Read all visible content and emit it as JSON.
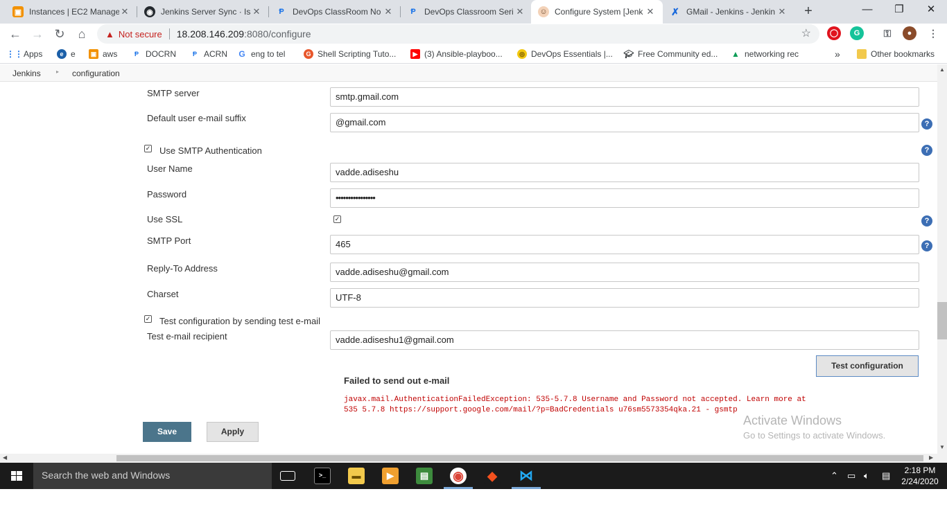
{
  "browser": {
    "tabs": [
      {
        "title": "Instances | EC2 Manage",
        "icon": "aws-icon"
      },
      {
        "title": "Jenkins Server Sync · Iss",
        "icon": "github-icon"
      },
      {
        "title": "DevOps ClassRoom No",
        "icon": "docs-icon"
      },
      {
        "title": "DevOps Classroom Seri",
        "icon": "docs-icon"
      },
      {
        "title": "Configure System [Jenk",
        "icon": "jenkins-icon"
      },
      {
        "title": "GMail - Jenkins - Jenkin",
        "icon": "confluence-icon"
      }
    ],
    "not_secure": "Not secure",
    "url_host": "18.208.146.209",
    "url_path": ":8080/configure"
  },
  "bookmarks": {
    "items": [
      {
        "label": "Apps"
      },
      {
        "label": "e"
      },
      {
        "label": "aws"
      },
      {
        "label": "DOCRN"
      },
      {
        "label": "ACRN"
      },
      {
        "label": "eng to tel"
      },
      {
        "label": "Shell Scripting Tuto..."
      },
      {
        "label": "(3) Ansible-playboo..."
      },
      {
        "label": "DevOps Essentials |..."
      },
      {
        "label": "Free Community ed..."
      },
      {
        "label": "networking rec"
      }
    ],
    "more": "»",
    "other": "Other bookmarks"
  },
  "breadcrumb": {
    "root": "Jenkins",
    "current": "configuration"
  },
  "form": {
    "smtp_server_label": "SMTP server",
    "smtp_server_value": "smtp.gmail.com",
    "suffix_label": "Default user e-mail suffix",
    "suffix_value": "@gmail.com",
    "use_smtp_auth_label": "Use SMTP Authentication",
    "use_smtp_auth_checked": true,
    "username_label": "User Name",
    "username_value": "vadde.adiseshu",
    "password_label": "Password",
    "password_value": "••••••••••••••••",
    "use_ssl_label": "Use SSL",
    "use_ssl_checked": true,
    "smtp_port_label": "SMTP Port",
    "smtp_port_value": "465",
    "reply_to_label": "Reply-To Address",
    "reply_to_value": "vadde.adiseshu@gmail.com",
    "charset_label": "Charset",
    "charset_value": "UTF-8",
    "test_config_label": "Test configuration by sending test e-mail",
    "test_config_checked": true,
    "test_recipient_label": "Test e-mail recipient",
    "test_recipient_value": "vadde.adiseshu1@gmail.com",
    "test_button": "Test configuration",
    "fail_heading": "Failed to send out e-mail",
    "error_line1": "javax.mail.AuthenticationFailedException: 535-5.7.8 Username and Password not accepted. Learn more at",
    "error_line2": "535 5.7.8  https://support.google.com/mail/?p=BadCredentials u76sm5573354qka.21 - gsmtp",
    "save_button": "Save",
    "apply_button": "Apply"
  },
  "watermark": {
    "line1": "Activate Windows",
    "line2": "Go to Settings to activate Windows."
  },
  "taskbar": {
    "search_placeholder": "Search the web and Windows",
    "time": "2:18 PM",
    "date": "2/24/2020"
  },
  "colors": {
    "jenkins_save": "#4b758b",
    "help_icon": "#3c6eb4",
    "error_text": "#c00000",
    "taskbar": "#1b1b1b"
  }
}
